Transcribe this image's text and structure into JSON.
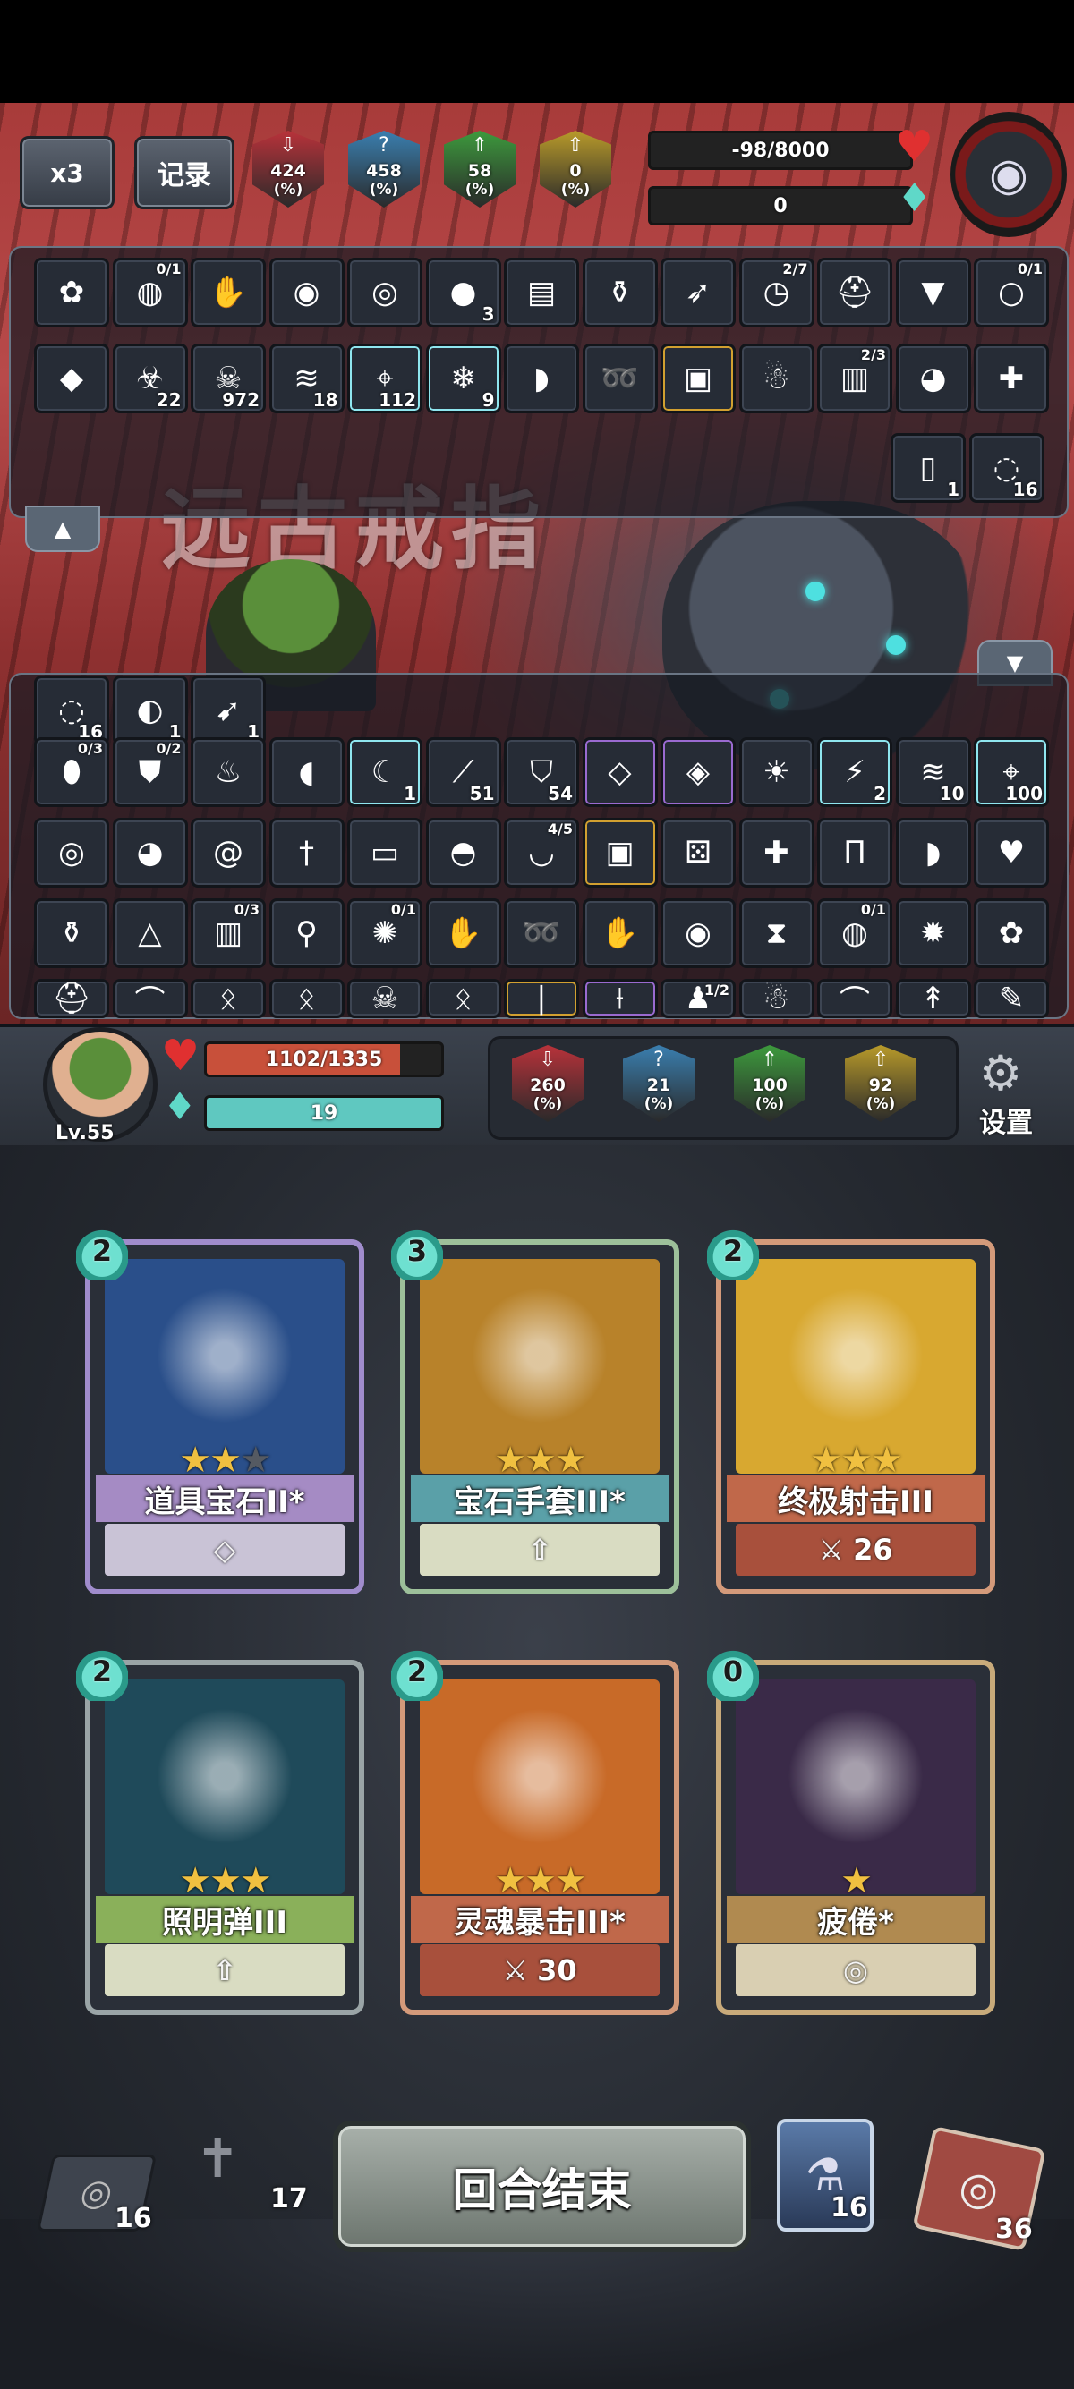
{
  "top": {
    "speed_label": "x3",
    "log_label": "记录",
    "enemy_stats": [
      {
        "icon": "down-arrow-icon",
        "value": "424",
        "unit": "(%)",
        "color": "#b8323a"
      },
      {
        "icon": "question-icon",
        "value": "458",
        "unit": "(%)",
        "color": "#3a7fb0"
      },
      {
        "icon": "shield-up-icon",
        "value": "58",
        "unit": "(%)",
        "color": "#3d9a3d"
      },
      {
        "icon": "arrow-up-icon",
        "value": "0",
        "unit": "(%)",
        "color": "#b89a2a"
      }
    ],
    "enemy_hp_text": "-98/8000",
    "enemy_hp_fraction": 0,
    "enemy_mana_text": "0",
    "boss_title": "远古戒指"
  },
  "enemy_items": {
    "row1": [
      {
        "icon": "rose-icon",
        "count": "",
        "frac": ""
      },
      {
        "icon": "sack-icon",
        "count": "",
        "frac": "0/1"
      },
      {
        "icon": "glove-icon",
        "count": "",
        "frac": ""
      },
      {
        "icon": "meat-icon",
        "count": "",
        "frac": ""
      },
      {
        "icon": "goggles-icon",
        "count": "",
        "frac": ""
      },
      {
        "icon": "orb-icon",
        "count": "3",
        "frac": ""
      },
      {
        "icon": "book-icon",
        "count": "",
        "frac": ""
      },
      {
        "icon": "potion-icon",
        "count": "",
        "frac": ""
      },
      {
        "icon": "arrows-icon",
        "count": "",
        "frac": ""
      },
      {
        "icon": "clock-icon",
        "count": "",
        "frac": "2/7"
      },
      {
        "icon": "helmet-icon",
        "count": "",
        "frac": ""
      },
      {
        "icon": "cloak-icon",
        "count": "",
        "frac": ""
      },
      {
        "icon": "ring-icon",
        "count": "",
        "frac": "0/1"
      }
    ],
    "row2": [
      {
        "icon": "crystal-icon",
        "count": "",
        "frac": ""
      },
      {
        "icon": "poison-icon",
        "count": "22",
        "frac": ""
      },
      {
        "icon": "skull-icon",
        "count": "972",
        "frac": ""
      },
      {
        "icon": "claw-icon",
        "count": "18",
        "frac": ""
      },
      {
        "icon": "target-icon",
        "count": "112",
        "frac": ""
      },
      {
        "icon": "snowflake-icon",
        "count": "9",
        "frac": ""
      },
      {
        "icon": "bread-icon",
        "count": "",
        "frac": ""
      },
      {
        "icon": "fish-icon",
        "count": "",
        "frac": ""
      },
      {
        "icon": "chest-icon",
        "count": "",
        "frac": ""
      },
      {
        "icon": "doll-icon",
        "count": "",
        "frac": ""
      },
      {
        "icon": "scroll-icon",
        "count": "",
        "frac": "2/3"
      },
      {
        "icon": "crystal-ball-icon",
        "count": "",
        "frac": ""
      },
      {
        "icon": "scarecrow-icon",
        "count": "",
        "frac": ""
      }
    ],
    "row3": [
      {
        "icon": "cards-icon",
        "count": "1",
        "frac": ""
      },
      {
        "icon": "vortex-icon",
        "count": "16",
        "frac": ""
      }
    ]
  },
  "player_items": {
    "row0": [
      {
        "icon": "vortex-icon",
        "count": "16",
        "frac": ""
      },
      {
        "icon": "watermelon-icon",
        "count": "1",
        "frac": ""
      },
      {
        "icon": "arrow-icon",
        "count": "1",
        "frac": ""
      }
    ],
    "row1": [
      {
        "icon": "egg-icon",
        "count": "",
        "frac": "0/3"
      },
      {
        "icon": "armor-icon",
        "count": "",
        "frac": "0/2"
      },
      {
        "icon": "chicken-icon",
        "count": "",
        "frac": ""
      },
      {
        "icon": "boxing-glove-icon",
        "count": "",
        "frac": ""
      },
      {
        "icon": "moon-icon",
        "count": "1",
        "frac": ""
      },
      {
        "icon": "blade-icon",
        "count": "51",
        "frac": ""
      },
      {
        "icon": "shield-icon",
        "count": "54",
        "frac": ""
      },
      {
        "icon": "gem-icon",
        "count": "",
        "frac": ""
      },
      {
        "icon": "ice-gem-icon",
        "count": "",
        "frac": ""
      },
      {
        "icon": "sun-icon",
        "count": "",
        "frac": ""
      },
      {
        "icon": "lightning-icon",
        "count": "2",
        "frac": ""
      },
      {
        "icon": "claw-icon",
        "count": "10",
        "frac": ""
      },
      {
        "icon": "target-icon",
        "count": "100",
        "frac": ""
      }
    ],
    "row2": [
      {
        "icon": "goggles-icon",
        "count": "",
        "frac": ""
      },
      {
        "icon": "crystal-ball-icon",
        "count": "",
        "frac": ""
      },
      {
        "icon": "spiral-icon",
        "count": "",
        "frac": ""
      },
      {
        "icon": "dagger-icon",
        "count": "",
        "frac": ""
      },
      {
        "icon": "card-icon",
        "count": "",
        "frac": ""
      },
      {
        "icon": "ham-icon",
        "count": "",
        "frac": ""
      },
      {
        "icon": "bowl-icon",
        "count": "",
        "frac": "4/5"
      },
      {
        "icon": "chest-icon",
        "count": "",
        "frac": ""
      },
      {
        "icon": "dice-icon",
        "count": "",
        "frac": ""
      },
      {
        "icon": "scarecrow-icon",
        "count": "",
        "frac": ""
      },
      {
        "icon": "pants-icon",
        "count": "",
        "frac": ""
      },
      {
        "icon": "bread-icon",
        "count": "",
        "frac": ""
      },
      {
        "icon": "heart-stone-icon",
        "count": "",
        "frac": ""
      }
    ],
    "row3": [
      {
        "icon": "potion-icon",
        "count": "",
        "frac": ""
      },
      {
        "icon": "rice-ball-icon",
        "count": "",
        "frac": ""
      },
      {
        "icon": "scroll-icon",
        "count": "",
        "frac": "0/3"
      },
      {
        "icon": "broom-icon",
        "count": "",
        "frac": ""
      },
      {
        "icon": "galaxy-icon",
        "count": "",
        "frac": "0/1"
      },
      {
        "icon": "glove-icon",
        "count": "",
        "frac": ""
      },
      {
        "icon": "fish-icon",
        "count": "",
        "frac": ""
      },
      {
        "icon": "glove-icon",
        "count": "",
        "frac": ""
      },
      {
        "icon": "meat-icon",
        "count": "",
        "frac": ""
      },
      {
        "icon": "hourglass-icon",
        "count": "",
        "frac": ""
      },
      {
        "icon": "sack-icon",
        "count": "",
        "frac": "0/1"
      },
      {
        "icon": "mine-icon",
        "count": "",
        "frac": ""
      },
      {
        "icon": "rose-icon",
        "count": "",
        "frac": ""
      }
    ],
    "row4": [
      {
        "icon": "helmet-icon",
        "count": "",
        "frac": ""
      },
      {
        "icon": "bow-icon",
        "count": "",
        "frac": ""
      },
      {
        "icon": "rune-icon",
        "count": "",
        "frac": ""
      },
      {
        "icon": "rune-icon",
        "count": "",
        "frac": ""
      },
      {
        "icon": "skull-icon",
        "count": "",
        "frac": ""
      },
      {
        "icon": "rune-icon",
        "count": "",
        "frac": ""
      },
      {
        "icon": "staff-icon",
        "count": "",
        "frac": ""
      },
      {
        "icon": "wand-icon",
        "count": "",
        "frac": ""
      },
      {
        "icon": "figure-icon",
        "count": "",
        "frac": "1/2"
      },
      {
        "icon": "doll-icon",
        "count": "",
        "frac": ""
      },
      {
        "icon": "bow-icon",
        "count": "",
        "frac": ""
      },
      {
        "icon": "spear-icon",
        "count": "",
        "frac": ""
      },
      {
        "icon": "brush-icon",
        "count": "",
        "frac": ""
      }
    ]
  },
  "player": {
    "level": "Lv.55",
    "hp_text": "1102/1335",
    "hp_fraction": 0.825,
    "mana_text": "19",
    "mana_fraction": 1,
    "stats": [
      {
        "icon": "down-arrow-icon",
        "value": "260",
        "unit": "(%)",
        "color": "#b8323a"
      },
      {
        "icon": "question-icon",
        "value": "21",
        "unit": "(%)",
        "color": "#3a7fb0"
      },
      {
        "icon": "shield-up-icon",
        "value": "100",
        "unit": "(%)",
        "color": "#3d9a3d"
      },
      {
        "icon": "arrow-up-icon",
        "value": "92",
        "unit": "(%)",
        "color": "#b89a2a"
      }
    ],
    "settings_label": "设置"
  },
  "cards": [
    {
      "cost": "2",
      "name": "道具宝石II*",
      "stars": 2,
      "max_stars": 3,
      "foot_icon": "diamond-icon",
      "foot_value": "",
      "border": "#a08ccc",
      "name_bg": "#a58bc4",
      "foot_bg": "#c9c3d6",
      "art": "#2a4f8a"
    },
    {
      "cost": "3",
      "name": "宝石手套III*",
      "stars": 3,
      "max_stars": 3,
      "foot_icon": "arrow-up-icon",
      "foot_value": "",
      "border": "#9dc09a",
      "name_bg": "#5aa0a8",
      "foot_bg": "#d9dcc2",
      "art": "#b8822a"
    },
    {
      "cost": "2",
      "name": "终极射击III",
      "stars": 3,
      "max_stars": 3,
      "foot_icon": "sword-icon",
      "foot_value": "26",
      "border": "#d49a7a",
      "name_bg": "#c0684a",
      "foot_bg": "#a8503c",
      "art": "#d8a830"
    },
    {
      "cost": "2",
      "name": "照明弹III",
      "stars": 3,
      "max_stars": 3,
      "foot_icon": "arrow-up-icon",
      "foot_value": "",
      "border": "#9aa4a6",
      "name_bg": "#8ab05a",
      "foot_bg": "#d9dcc2",
      "art": "#1f4a5a"
    },
    {
      "cost": "2",
      "name": "灵魂暴击III*",
      "stars": 3,
      "max_stars": 3,
      "foot_icon": "sword-icon",
      "foot_value": "30",
      "border": "#d49a7a",
      "name_bg": "#c0684a",
      "foot_bg": "#a8503c",
      "art": "#c86a28"
    },
    {
      "cost": "0",
      "name": "疲倦*",
      "stars": 1,
      "max_stars": 1,
      "foot_icon": "swirl-icon",
      "foot_value": "",
      "border": "#c8aa7a",
      "name_bg": "#b08a50",
      "foot_bg": "#d9cfb2",
      "art": "#3a2a48"
    }
  ],
  "bottom": {
    "draw_pile_count": "16",
    "grave_count": "17",
    "end_turn_label": "回合结束",
    "potion_count": "16",
    "discard_pile_count": "36"
  }
}
